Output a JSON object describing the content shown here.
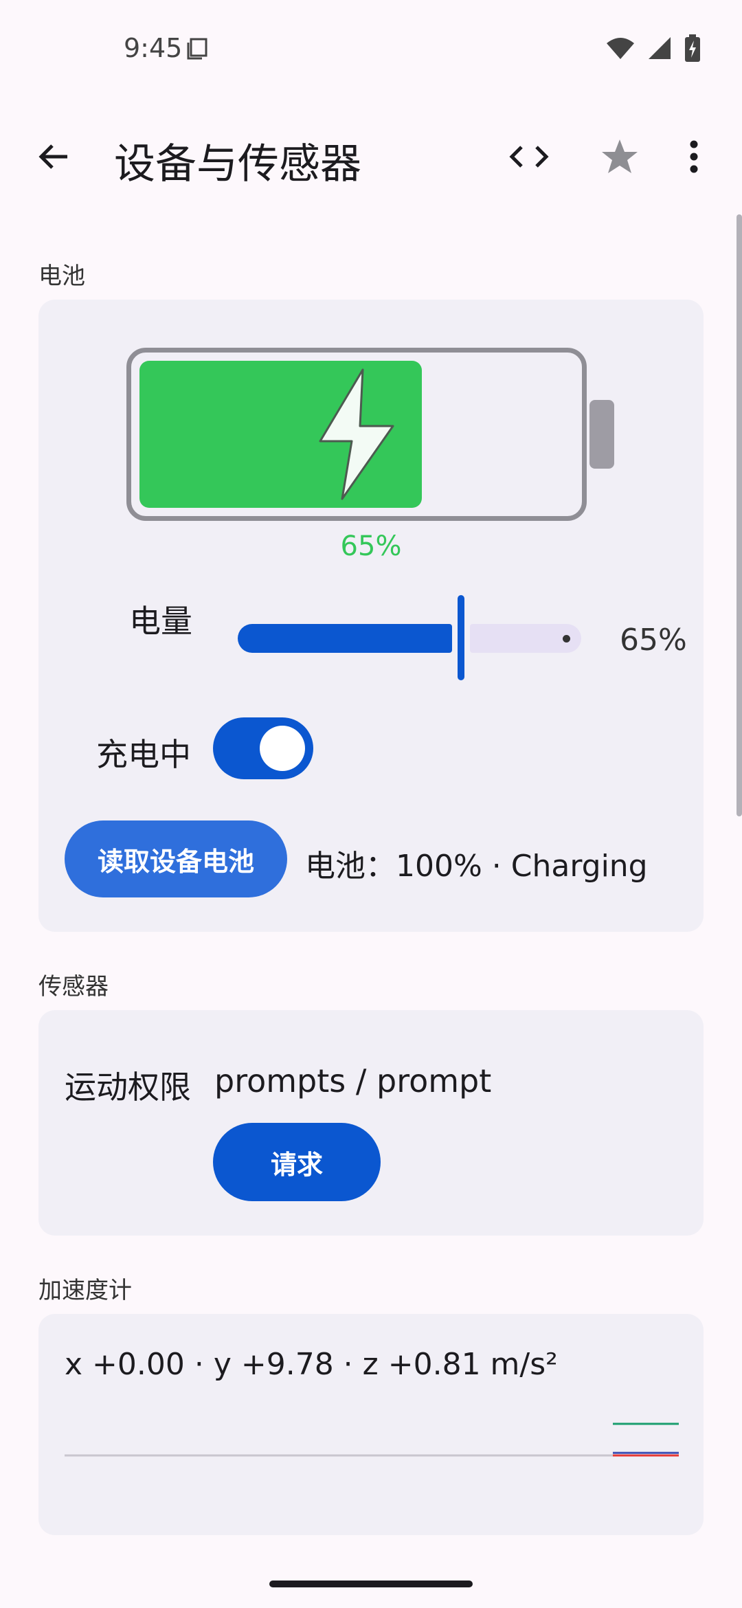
{
  "status_bar": {
    "time": "9:45",
    "icons": [
      "screen-record-icon",
      "wifi-icon",
      "signal-icon",
      "battery-charging-icon"
    ]
  },
  "app_bar": {
    "title": "设备与传感器",
    "icons": [
      "back-arrow-icon",
      "code-icon",
      "star-icon",
      "more-vert-icon"
    ]
  },
  "battery_section": {
    "header": "电池",
    "level_percent": 65,
    "level_label_display": "65%",
    "slider_label": "电量",
    "slider_value_display": "65%",
    "charging_label": "充电中",
    "charging_on": true,
    "read_button_label": "读取设备电池",
    "status_text": "电池：100% · Charging",
    "colors": {
      "fill": "#34c759",
      "accent": "#0b57d0"
    }
  },
  "sensors_section": {
    "header": "传感器",
    "motion_label": "运动权限",
    "motion_value": "prompts / prompt",
    "request_button_label": "请求"
  },
  "accelerometer_section": {
    "header": "加速度计",
    "readout": "x +0.00 · y +9.78 · z +0.81 m/s²",
    "traces": [
      {
        "axis": "x",
        "value": 0.0,
        "color": "#e53935"
      },
      {
        "axis": "y",
        "value": 9.78,
        "color": "#1a9e6e"
      },
      {
        "axis": "z",
        "value": 0.81,
        "color": "#3f51b5"
      }
    ]
  }
}
